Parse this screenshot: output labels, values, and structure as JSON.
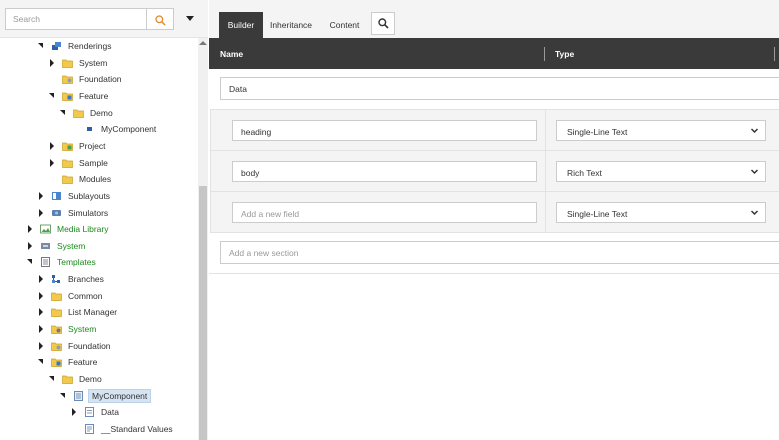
{
  "search": {
    "placeholder": "Search"
  },
  "tree": [
    {
      "label": "Renderings",
      "arrow": "e",
      "icon": "renderings-icon",
      "indent": 0,
      "green": false,
      "selected": false
    },
    {
      "label": "System",
      "arrow": "c",
      "icon": "folder-icon",
      "indent": 1,
      "green": false,
      "selected": false
    },
    {
      "label": "Foundation",
      "arrow": "",
      "icon": "foundation-folder-icon",
      "indent": 1,
      "green": false,
      "selected": false
    },
    {
      "label": "Feature",
      "arrow": "e",
      "icon": "feature-folder-icon",
      "indent": 1,
      "green": false,
      "selected": false
    },
    {
      "label": "Demo",
      "arrow": "e",
      "icon": "folder-icon",
      "indent": 2,
      "green": false,
      "selected": false
    },
    {
      "label": "MyComponent",
      "arrow": "",
      "icon": "rendering-item-icon",
      "indent": 3,
      "green": false,
      "selected": false
    },
    {
      "label": "Project",
      "arrow": "c",
      "icon": "project-folder-icon",
      "indent": 1,
      "green": false,
      "selected": false
    },
    {
      "label": "Sample",
      "arrow": "c",
      "icon": "folder-icon",
      "indent": 1,
      "green": false,
      "selected": false
    },
    {
      "label": "Modules",
      "arrow": "",
      "icon": "folder-icon",
      "indent": 1,
      "green": false,
      "selected": false
    },
    {
      "label": "Sublayouts",
      "arrow": "c",
      "icon": "sublayout-icon",
      "indent": 0,
      "green": false,
      "selected": false
    },
    {
      "label": "Simulators",
      "arrow": "c",
      "icon": "simulator-icon",
      "indent": 0,
      "green": false,
      "selected": false
    },
    {
      "label": "Media Library",
      "arrow": "c",
      "icon": "media-library-icon",
      "indent": -1,
      "green": true,
      "selected": false
    },
    {
      "label": "System",
      "arrow": "c",
      "icon": "system-icon",
      "indent": -1,
      "green": true,
      "selected": false
    },
    {
      "label": "Templates",
      "arrow": "e",
      "icon": "templates-icon",
      "indent": -1,
      "green": true,
      "selected": false
    },
    {
      "label": "Branches",
      "arrow": "c",
      "icon": "branches-icon",
      "indent": 0,
      "green": false,
      "selected": false
    },
    {
      "label": "Common",
      "arrow": "c",
      "icon": "folder-icon",
      "indent": 0,
      "green": false,
      "selected": false
    },
    {
      "label": "List Manager",
      "arrow": "c",
      "icon": "folder-icon",
      "indent": 0,
      "green": false,
      "selected": false
    },
    {
      "label": "System",
      "arrow": "c",
      "icon": "system-folder-icon",
      "indent": 0,
      "green": true,
      "selected": false
    },
    {
      "label": "Foundation",
      "arrow": "c",
      "icon": "foundation-folder-icon",
      "indent": 0,
      "green": false,
      "selected": false
    },
    {
      "label": "Feature",
      "arrow": "e",
      "icon": "feature-folder-icon",
      "indent": 0,
      "green": false,
      "selected": false
    },
    {
      "label": "Demo",
      "arrow": "e",
      "icon": "folder-icon",
      "indent": 1,
      "green": false,
      "selected": false
    },
    {
      "label": "MyComponent",
      "arrow": "e",
      "icon": "template-icon",
      "indent": 2,
      "green": false,
      "selected": true
    },
    {
      "label": "Data",
      "arrow": "c",
      "icon": "template-section-icon",
      "indent": 3,
      "green": false,
      "selected": false
    },
    {
      "label": "__Standard Values",
      "arrow": "",
      "icon": "standard-values-icon",
      "indent": 3,
      "green": false,
      "selected": false
    }
  ],
  "tabs": [
    {
      "label": "Builder",
      "active": true
    },
    {
      "label": "Inheritance",
      "active": false
    },
    {
      "label": "Content",
      "active": false
    }
  ],
  "header": {
    "name": "Name",
    "type": "Type"
  },
  "section": {
    "name": "Data"
  },
  "fields": [
    {
      "name": "heading",
      "type": "Single-Line Text",
      "placeholder": false
    },
    {
      "name": "body",
      "type": "Rich Text",
      "placeholder": false
    },
    {
      "name": "Add a new field",
      "type": "Single-Line Text",
      "placeholder": true
    }
  ],
  "new_section": {
    "placeholder": "Add a new section"
  },
  "colors": {
    "header_bg": "#3a3a3a",
    "green_label": "#1a8a1a",
    "selected_bg": "#d4e4f2"
  }
}
